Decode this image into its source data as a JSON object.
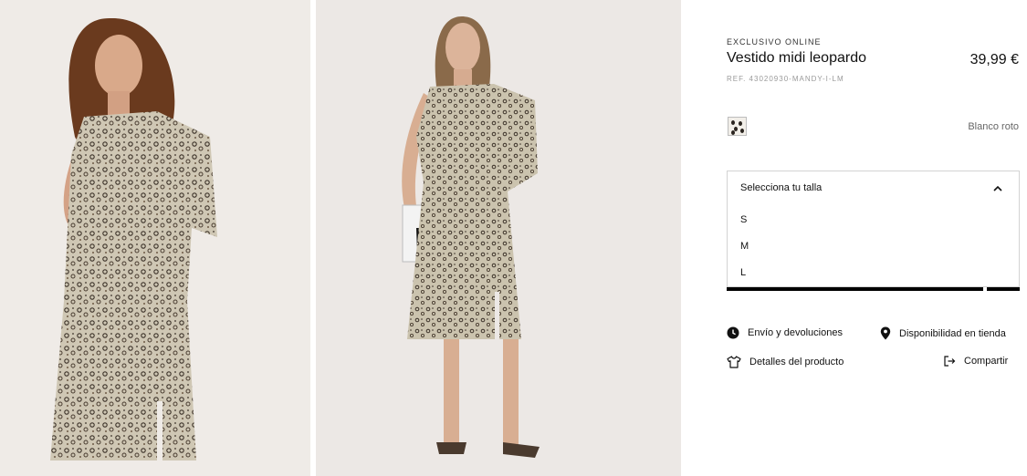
{
  "product": {
    "eyebrow": "EXCLUSIVO ONLINE",
    "title": "Vestido midi leopardo",
    "price": "39,99 €",
    "ref": "REF. 43020930-MANDY-I-LM"
  },
  "color": {
    "selected_name": "Blanco roto",
    "swatch_icon": "leopard-print-swatch"
  },
  "size_selector": {
    "label": "Selecciona tu talla",
    "options": [
      "S",
      "M",
      "L"
    ],
    "expanded": true
  },
  "links": {
    "shipping": "Envío y devoluciones",
    "store_availability": "Disponibilidad en tienda",
    "details": "Detalles del producto",
    "share": "Compartir"
  },
  "colors": {
    "accent": "#000000",
    "muted_text": "#9a9a9a",
    "border": "#d3d3d3"
  }
}
